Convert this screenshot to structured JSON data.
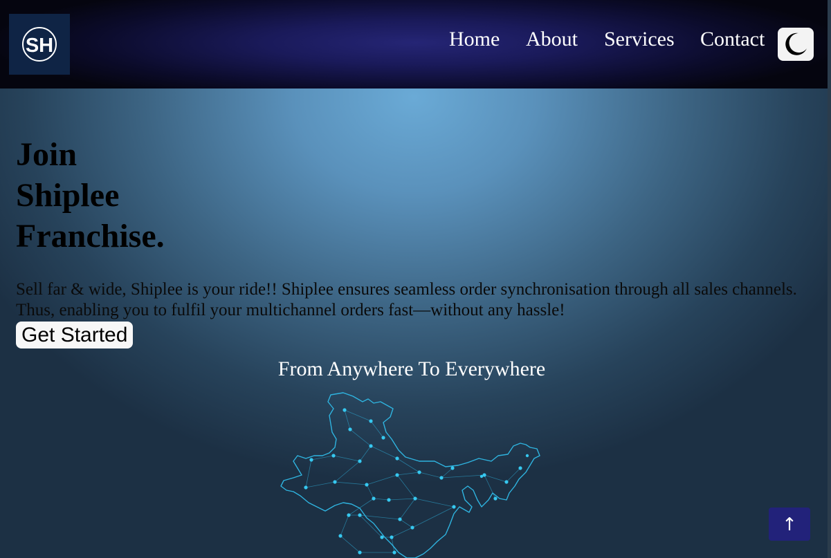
{
  "header": {
    "logo_text": "SH",
    "nav": {
      "home": "Home",
      "about": "About",
      "services": "Services",
      "contact": "Contact"
    },
    "theme_toggle_icon": "moon-icon"
  },
  "hero": {
    "title_line_1": "Join",
    "title_line_2": "Shiplee",
    "title_line_3": "Franchise.",
    "description": "Sell far & wide, Shiplee is your ride!! Shiplee ensures seamless order synchronisation through all sales channels. Thus, enabling you to fulfil your multichannel orders fast—without any hassle!",
    "cta_label": "Get Started"
  },
  "coverage": {
    "heading": "From Anywhere To Everywhere",
    "map_icon": "india-network-map"
  },
  "scroll_top": {
    "label": "↑"
  },
  "colors": {
    "header_bg": "#1a1a5a",
    "logo_bg": "#0f2445",
    "scroll_top_bg": "#22227a",
    "map_line": "#2fb4e0",
    "map_node": "#36c8f0"
  }
}
